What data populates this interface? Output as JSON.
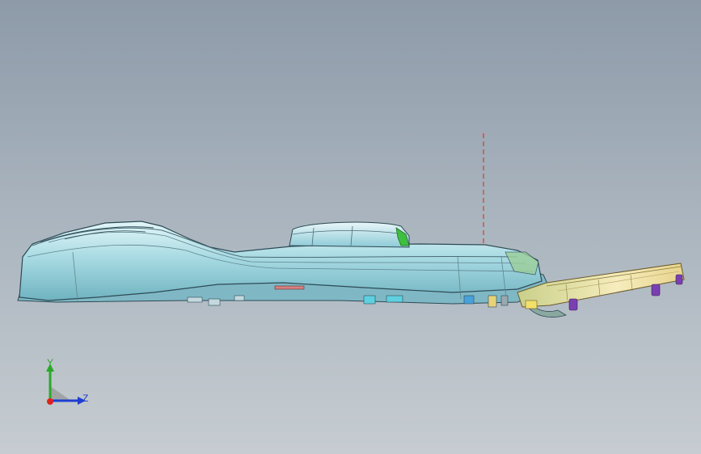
{
  "viewport": {
    "background_top": "#8d9aa8",
    "background_bottom": "#c6ccd1"
  },
  "model": {
    "body_color": "#bfe6ec",
    "accent_green": "#3fbf3f",
    "tray_color": "#f2e4a8",
    "connector_color": "#7a3fb0",
    "reference_line_color": "#e02020"
  },
  "triad": {
    "y_label": "Y",
    "z_label": "Z",
    "y_color": "#2aa82a",
    "z_color": "#1e3fd0",
    "x_color": "#e02020"
  }
}
